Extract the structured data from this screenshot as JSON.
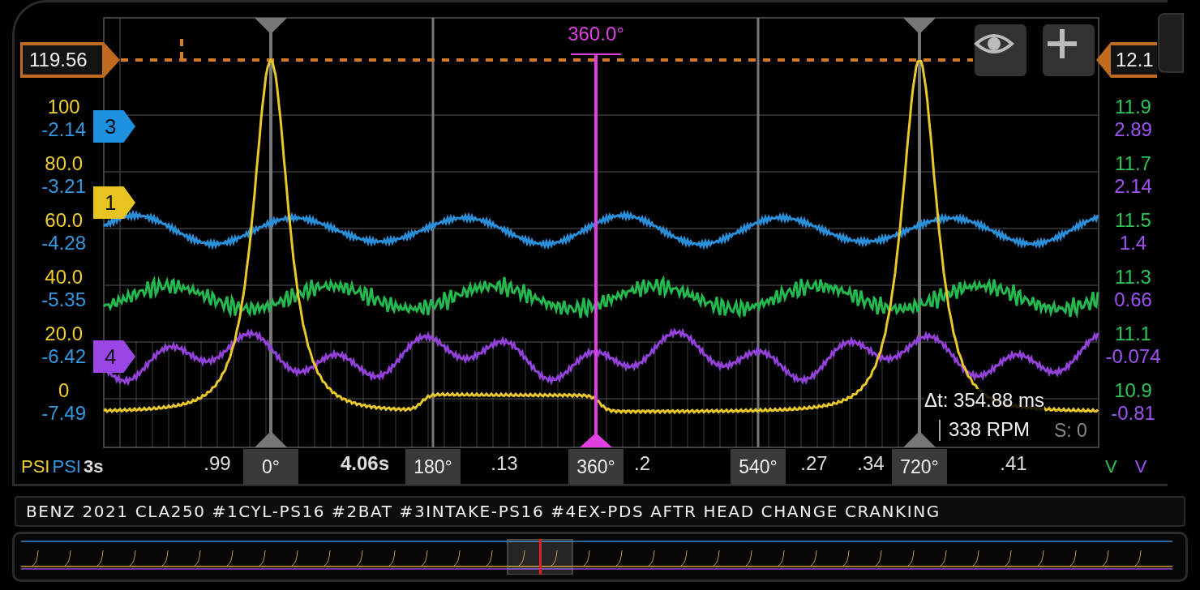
{
  "plot": {
    "reference": {
      "left_value": "119.56",
      "right_value": "12.1"
    },
    "cursor": {
      "label": "360.0°"
    },
    "channels": [
      {
        "marker": "3",
        "color": "#1e90e0"
      },
      {
        "marker": "1",
        "color": "#e8c420"
      },
      {
        "marker": "4",
        "color": "#9a45e6"
      }
    ],
    "toolbar": [
      {
        "kind": "eye"
      },
      {
        "kind": "plus"
      }
    ],
    "measurement": {
      "delta": "Δt: 354.88 ms",
      "rpm": "338 RPM",
      "samples": "S: 0"
    }
  },
  "left_axis": {
    "ticks": [
      {
        "primary": "100",
        "secondary": "-2.14"
      },
      {
        "primary": "80.0",
        "secondary": "-3.21"
      },
      {
        "primary": "60.0",
        "secondary": "-4.28"
      },
      {
        "primary": "40.0",
        "secondary": "-5.35"
      },
      {
        "primary": "20.0",
        "secondary": "-6.42"
      },
      {
        "primary": "0",
        "secondary": "-7.49"
      }
    ],
    "units": [
      "PSI",
      "PSI"
    ],
    "time_span": "3s"
  },
  "right_axis": {
    "ticks": [
      {
        "primary": "11.9",
        "secondary": "2.89"
      },
      {
        "primary": "11.7",
        "secondary": "2.14"
      },
      {
        "primary": "11.5",
        "secondary": "1.4"
      },
      {
        "primary": "11.3",
        "secondary": "0.66"
      },
      {
        "primary": "11.1",
        "secondary": "-0.074"
      },
      {
        "primary": "10.9",
        "secondary": "-0.81"
      }
    ],
    "units": [
      "V",
      "V"
    ]
  },
  "x_axis": {
    "time_labels": [
      ".99",
      "4.06s",
      ".13",
      ".2",
      ".27",
      ".34",
      ".41"
    ],
    "angle_labels": [
      "0°",
      "180°",
      "360°",
      "540°",
      "720°"
    ]
  },
  "title": "BENZ 2021 CLA250 #1CYL-PS16 #2BAT #3INTAKE-PS16 #4EX-PDS AFTR HEAD CHANGE CRANKING"
}
